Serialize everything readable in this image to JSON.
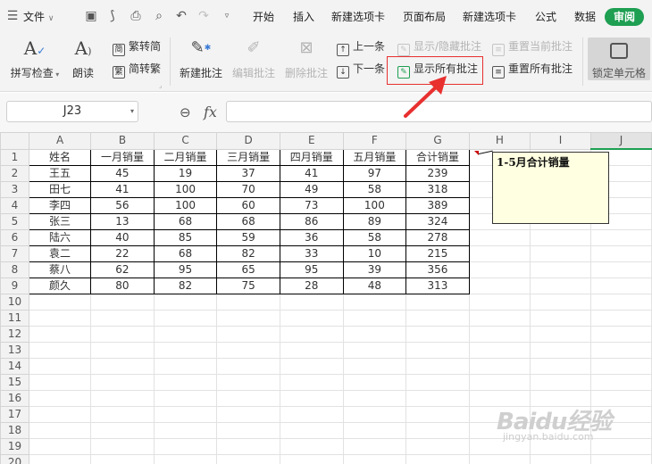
{
  "menu": {
    "file_label": "文件",
    "tabs": [
      "开始",
      "插入",
      "新建选项卡",
      "页面布局",
      "新建选项卡",
      "公式",
      "数据"
    ],
    "active_tab": "审阅",
    "active_color": "#1e9f52"
  },
  "ribbon": {
    "spell_check": "拼写检查",
    "read_aloud": "朗读",
    "trad_to_simp": "繁转简",
    "simp_to_trad": "简转繁",
    "new_comment": "新建批注",
    "edit_comment": "编辑批注",
    "delete_comment": "删除批注",
    "prev_comment": "上一条",
    "next_comment": "下一条",
    "show_hide_comment": "显示/隐藏批注",
    "show_all_comments": "显示所有批注",
    "reset_current_comment": "重置当前批注",
    "reset_all_comments": "重置所有批注",
    "lock_cell": "锁定单元格",
    "highlight_color": "#e8302f"
  },
  "formula_bar": {
    "cell_ref": "J23",
    "fx_label": "fx",
    "formula": ""
  },
  "sheet": {
    "col_letters": [
      "A",
      "B",
      "C",
      "D",
      "E",
      "F",
      "G",
      "H",
      "I",
      "J"
    ],
    "selected_col": "J",
    "row_numbers": [
      "1",
      "2",
      "3",
      "4",
      "5",
      "6",
      "7",
      "8",
      "9",
      "10",
      "11",
      "12",
      "13",
      "14",
      "15",
      "16",
      "17",
      "18",
      "19",
      "20"
    ],
    "headers": [
      "姓名",
      "一月销量",
      "二月销量",
      "三月销量",
      "四月销量",
      "五月销量",
      "合计销量"
    ],
    "rows": [
      [
        "王五",
        "45",
        "19",
        "37",
        "41",
        "97",
        "239"
      ],
      [
        "田七",
        "41",
        "100",
        "70",
        "49",
        "58",
        "318"
      ],
      [
        "李四",
        "56",
        "100",
        "60",
        "73",
        "100",
        "389"
      ],
      [
        "张三",
        "13",
        "68",
        "68",
        "86",
        "89",
        "324"
      ],
      [
        "陆六",
        "40",
        "85",
        "59",
        "36",
        "58",
        "278"
      ],
      [
        "袁二",
        "22",
        "68",
        "82",
        "33",
        "10",
        "215"
      ],
      [
        "蔡八",
        "62",
        "95",
        "65",
        "95",
        "39",
        "356"
      ],
      [
        "颜久",
        "80",
        "82",
        "75",
        "28",
        "48",
        "313"
      ]
    ]
  },
  "comment": {
    "text": "1-5月合计销量"
  },
  "watermark": {
    "brand": "Baidu经验",
    "url": "jingyan.baidu.com"
  }
}
